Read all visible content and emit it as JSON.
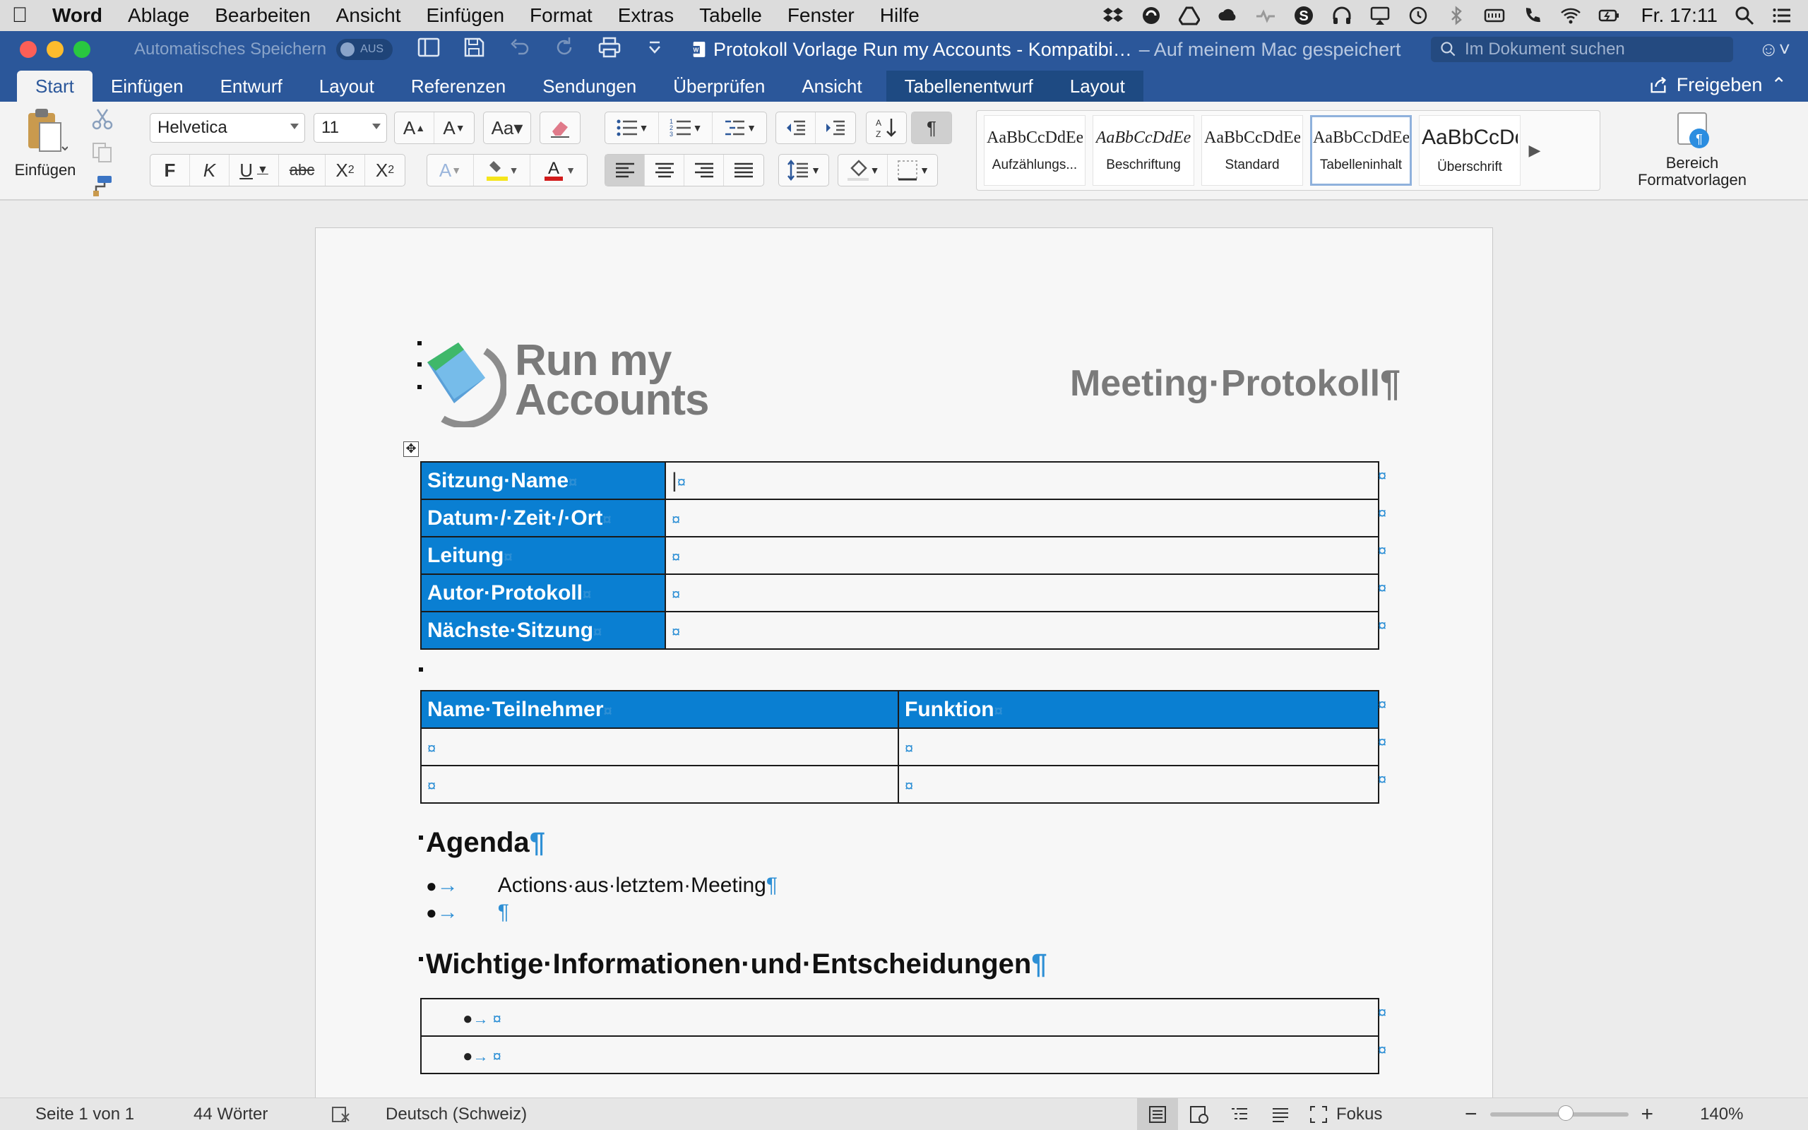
{
  "menubar": {
    "app": "Word",
    "items": [
      "Ablage",
      "Bearbeiten",
      "Ansicht",
      "Einfügen",
      "Format",
      "Extras",
      "Tabelle",
      "Fenster",
      "Hilfe"
    ],
    "clock": "Fr. 17:11"
  },
  "titlebar": {
    "autosave_label": "Automatisches Speichern",
    "autosave_state": "AUS",
    "doc_name": "Protokoll Vorlage Run my Accounts  -  Kompatibi…",
    "location": "– Auf meinem Mac gespeichert",
    "search_placeholder": "Im Dokument suchen"
  },
  "tabs": [
    {
      "label": "Start",
      "active": true
    },
    {
      "label": "Einfügen"
    },
    {
      "label": "Entwurf"
    },
    {
      "label": "Layout"
    },
    {
      "label": "Referenzen"
    },
    {
      "label": "Sendungen"
    },
    {
      "label": "Überprüfen"
    },
    {
      "label": "Ansicht"
    },
    {
      "label": "Tabellenentwurf",
      "contextual": true
    },
    {
      "label": "Layout",
      "contextual": true
    }
  ],
  "share_label": "Freigeben",
  "ribbon": {
    "paste_label": "Einfügen",
    "font_name": "Helvetica",
    "font_size": "11",
    "format_buttons": {
      "bold": "F",
      "italic": "K",
      "underline": "U",
      "strike": "abc"
    },
    "styles": [
      {
        "preview": "AaBbCcDdEe",
        "name": "Aufzählungs..."
      },
      {
        "preview": "AaBbCcDdEe",
        "name": "Beschriftung"
      },
      {
        "preview": "AaBbCcDdEe",
        "name": "Standard"
      },
      {
        "preview": "AaBbCcDdEe",
        "name": "Tabelleninhalt",
        "selected": true
      },
      {
        "preview": "AaBbCcDd",
        "name": "Überschrift"
      }
    ],
    "styles_pane_label_1": "Bereich",
    "styles_pane_label_2": "Formatvorlagen",
    "colors": {
      "highlight": "#f5e51b",
      "font_color": "#d21b1b"
    }
  },
  "document": {
    "logo_line1": "Run my",
    "logo_line2": "Accounts",
    "title": "Meeting·Protokoll",
    "meta_table": {
      "rows": [
        {
          "label": "Sitzung·Name"
        },
        {
          "label": "Datum·/·Zeit·/·Ort"
        },
        {
          "label": "Leitung"
        },
        {
          "label": "Autor·Protokoll"
        },
        {
          "label": "Nächste·Sitzung"
        }
      ]
    },
    "participants_table": {
      "headers": [
        "Name·Teilnehmer",
        "Funktion"
      ],
      "row_count": 2
    },
    "agenda_heading": "Agenda",
    "agenda_items": [
      "Actions·aus·letztem·Meeting",
      ""
    ],
    "info_heading": "Wichtige·Informationen·und·Entscheidungen",
    "info_rows": 2
  },
  "statusbar": {
    "page": "Seite 1 von 1",
    "words": "44 Wörter",
    "language": "Deutsch (Schweiz)",
    "focus": "Fokus",
    "zoom": "140%",
    "zoom_value": 140
  },
  "accent": "#2b579a",
  "table_header_color": "#0a7fd2"
}
